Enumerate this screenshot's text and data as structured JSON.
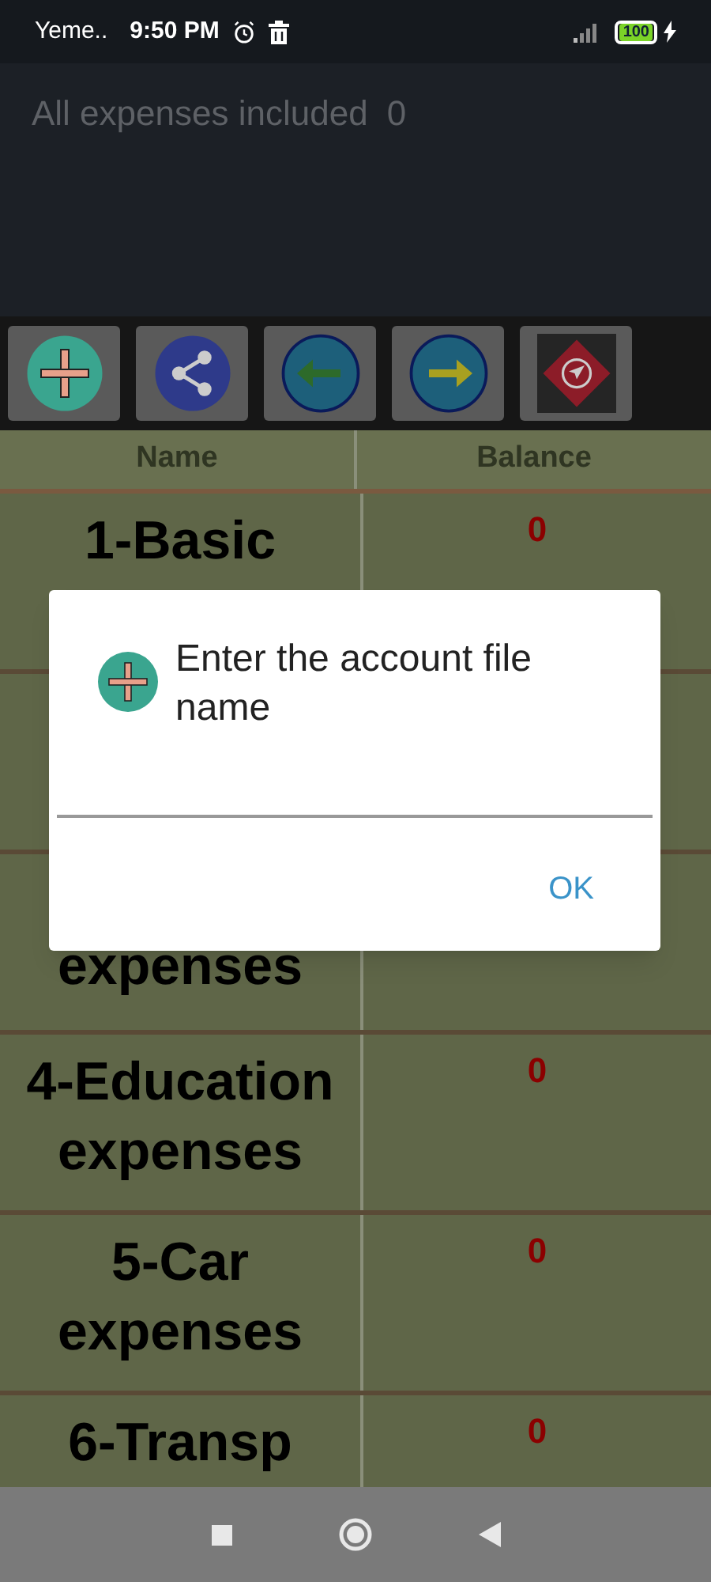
{
  "status_bar": {
    "carrier": "Yeme..",
    "time": "9:50 PM",
    "battery": "100"
  },
  "header": {
    "title": "All expenses included",
    "total": "0"
  },
  "toolbar": [
    {
      "kind": "add"
    },
    {
      "kind": "share"
    },
    {
      "kind": "back"
    },
    {
      "kind": "forward"
    },
    {
      "kind": "navigate"
    }
  ],
  "table": {
    "columns": [
      "Name",
      "Balance"
    ],
    "rows": [
      {
        "kind": "normal",
        "name": "1-Basic",
        "balance": "0"
      },
      {
        "kind": "covered"
      },
      {
        "kind": "cut_top",
        "name": "expenses"
      },
      {
        "kind": "normal",
        "name": "4-Education expenses",
        "balance": "0"
      },
      {
        "kind": "normal",
        "name": "5-Car expenses",
        "balance": "0"
      },
      {
        "kind": "normal",
        "name": "6-Transp",
        "balance": "0"
      }
    ]
  },
  "dialog": {
    "title": "Enter the account file name",
    "button": "OK"
  }
}
